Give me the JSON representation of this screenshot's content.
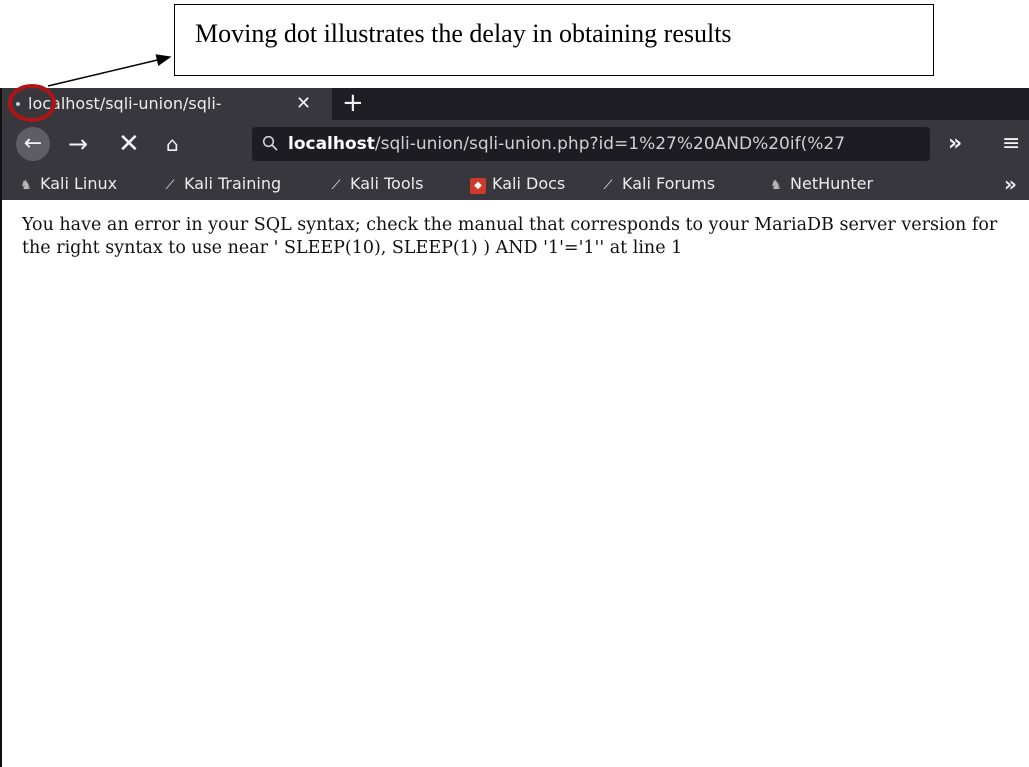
{
  "annotation": {
    "text": "Moving dot illustrates the delay in obtaining results"
  },
  "tab": {
    "title": "localhost/sqli-union/sqli-",
    "close_glyph": "✕",
    "new_tab_glyph": "+"
  },
  "navbar": {
    "back_glyph": "←",
    "forward_glyph": "→",
    "stop_glyph": "✕",
    "home_glyph": "⌂",
    "url_host": "localhost",
    "url_path": "/sqli-union/sqli-union.php?id=1%27%20AND%20if(%27",
    "overflow_glyph": "»",
    "menu_glyph": "≡"
  },
  "bookmarks": {
    "items": [
      {
        "label": "Kali Linux",
        "icon": "dragon-icon"
      },
      {
        "label": "Kali Training",
        "icon": "kali-icon"
      },
      {
        "label": "Kali Tools",
        "icon": "kali-icon"
      },
      {
        "label": "Kali Docs",
        "icon": "docs-icon"
      },
      {
        "label": "Kali Forums",
        "icon": "kali-icon"
      },
      {
        "label": "NetHunter",
        "icon": "dragon-icon"
      }
    ],
    "overflow_glyph": "»"
  },
  "page": {
    "error_message": "You have an error in your SQL syntax; check the manual that corresponds to your MariaDB server version for the right syntax to use near ' SLEEP(10), SLEEP(1) ) AND '1'='1'' at line 1"
  },
  "colors": {
    "highlight_circle": "#b01515",
    "browser_chrome": "#38373e",
    "tab_strip": "#1f1e25"
  }
}
